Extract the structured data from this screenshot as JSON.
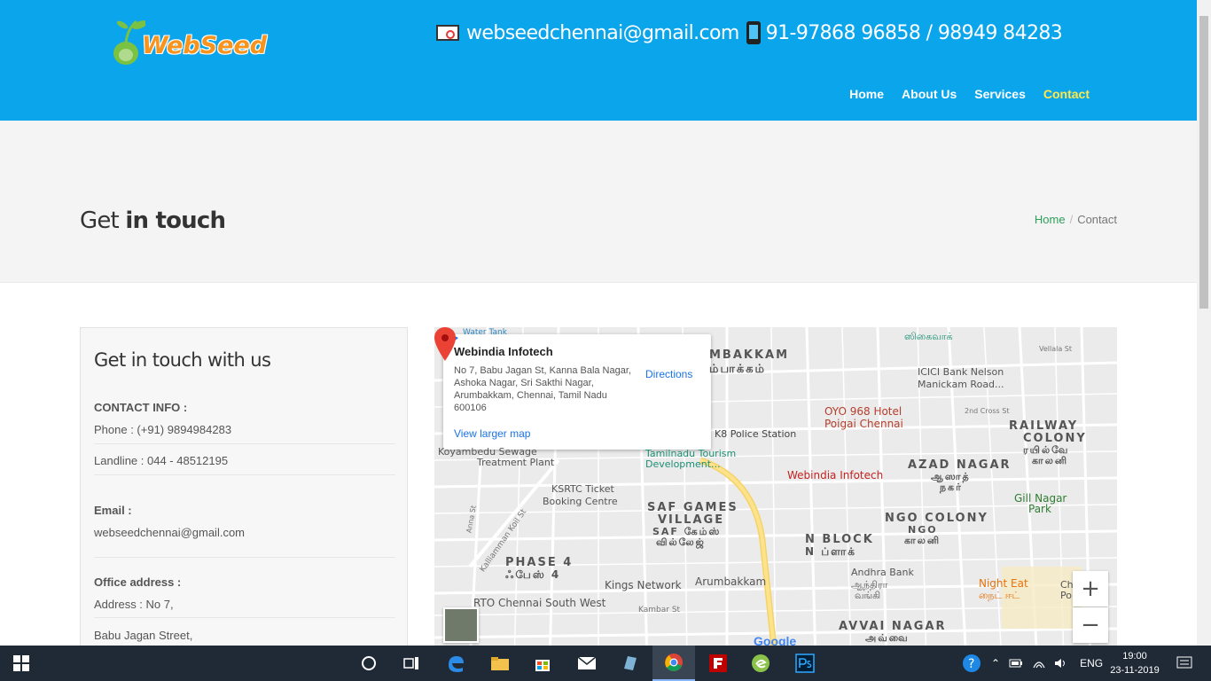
{
  "header": {
    "logo_text": "WebSeed",
    "email": "webseedchennai@gmail.com",
    "phone": "91-97868 96858 / 98949 84283",
    "nav": [
      {
        "label": "Home"
      },
      {
        "label": "About Us"
      },
      {
        "label": "Services"
      },
      {
        "label": "Contact"
      }
    ],
    "colors": {
      "bg": "#0ba5ec",
      "active_nav": "#ffe94a"
    }
  },
  "title_band": {
    "title_light": "Get",
    "title_bold": "in touch",
    "breadcrumb_home": "Home",
    "breadcrumb_sep": "/",
    "breadcrumb_current": "Contact"
  },
  "card": {
    "heading": "Get in touch with us",
    "contact_info_label": "CONTACT INFO :",
    "phone": "Phone : (+91) 9894984283",
    "landline": "Landline : 044 - 48512195",
    "email_label": "Email :",
    "email": "webseedchennai@gmail.com",
    "office_label": "Office address :",
    "address_1": "Address : No 7,",
    "address_2": "Babu Jagan Street,"
  },
  "map": {
    "place_name": "Webindia Infotech",
    "place_address": "No 7, Babu Jagan St, Kanna Bala Nagar, Ashoka Nagar, Sri Sakthi Nagar, Arumbakkam, Chennai, Tamil Nadu 600106",
    "view_larger": "View larger map",
    "directions": "Directions",
    "marker_label": "Webindia Infotech",
    "zoom_in": "+",
    "zoom_out": "−",
    "google": "Google",
    "labels": {
      "mbakkam": "MBAKKAM",
      "mbakkam_ta": "ம்பாக்கம்",
      "oyo": "OYO 968 Hotel",
      "oyo2": "Poigai Chennai",
      "icici": "ICICI Bank Nelson",
      "icici2": "Manickam Road...",
      "k8": "K8 Police Station",
      "tamilnadu": "Tamilnadu Tourism",
      "tamilnadu2": "Development...",
      "sewage": "Koyambedu Sewage",
      "sewage2": "Treatment Plant",
      "ksrtc": "KSRTC Ticket",
      "ksrtc2": "Booking Centre",
      "saf": "SAF GAMES",
      "saf2": "VILLAGE",
      "saf3": "SAF கேம்ஸ்",
      "saf4": "வில்லேஜ்",
      "azad": "AZAD NAGAR",
      "azad_ta": "ஆஸாத்",
      "azad_ta2": "நகர்",
      "railway": "RAILWAY",
      "railway2": "COLONY",
      "railway3": "ரயில்வே",
      "railway4": "காலனி",
      "gill": "Gill Nagar",
      "gill2": "Park",
      "ngo": "NGO COLONY",
      "ngo2": "NGO",
      "ngo3": "காலனி",
      "nblock": "N BLOCK",
      "nblock2": "N ப்ளாக்",
      "phase": "PHASE 4",
      "phase_ta": "ஃபேஸ் 4",
      "kings": "Kings Network",
      "arumbakkam": "Arumbakkam",
      "andhra": "Andhra Bank",
      "andhra2": "ஆந்திரா",
      "andhra3": "வங்கி",
      "nighteat": "Night Eat",
      "nighteat2": "நைட் ஈட்",
      "rto": "RTO Chennai South West",
      "kambar": "Kambar St",
      "avvai": "AVVAI NAGAR",
      "avvai2": "அவ்வை",
      "kalliamman": "Kalliamman Koil St",
      "watertank": "Water Tank",
      "cho": "Cho",
      "polic": "Polic",
      "vellala": "Vellala St",
      "second_cross": "2nd Cross St",
      "sigaivag": "ஸிகைவாக்",
      "annast": "Anna St"
    }
  },
  "taskbar": {
    "lang": "ENG",
    "time": "19:00",
    "date": "23-11-2019"
  }
}
